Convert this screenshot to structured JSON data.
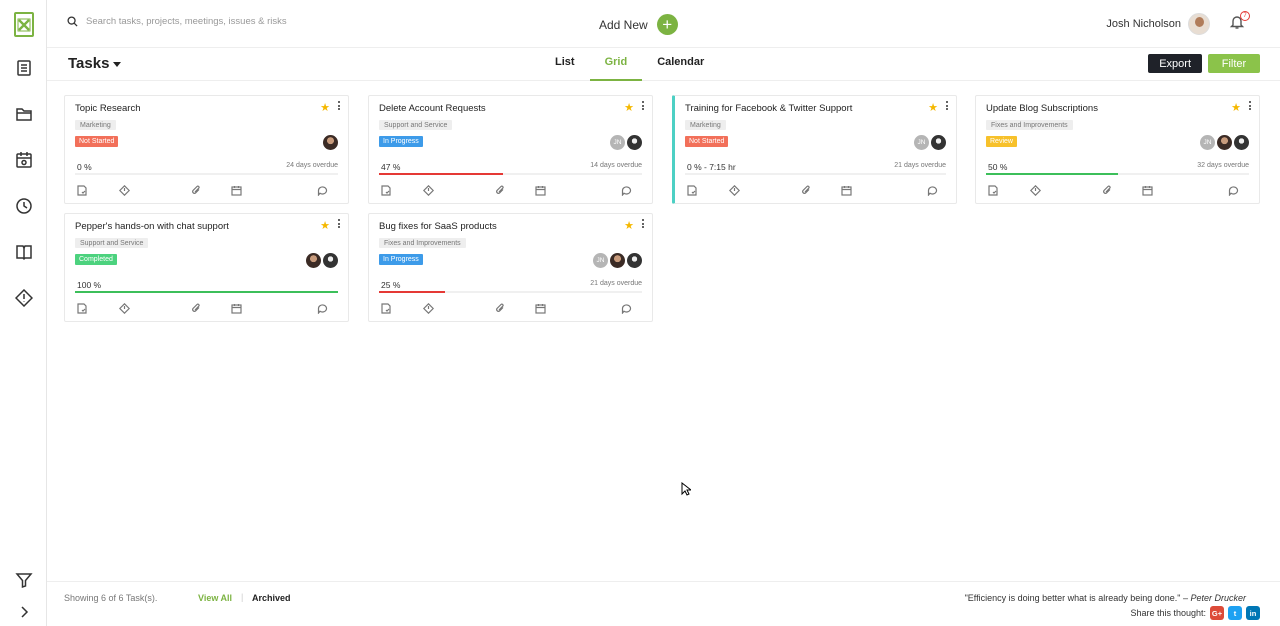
{
  "search": {
    "placeholder": "Search tasks, projects, meetings, issues & risks"
  },
  "header": {
    "add_new_label": "Add New",
    "user_name": "Josh Nicholson",
    "notification_count": "7"
  },
  "page": {
    "title": "Tasks"
  },
  "view_tabs": [
    {
      "label": "List",
      "active": false
    },
    {
      "label": "Grid",
      "active": true
    },
    {
      "label": "Calendar",
      "active": false
    }
  ],
  "actions": {
    "export_label": "Export",
    "filter_label": "Filter"
  },
  "colors": {
    "accent_green": "#7cb342",
    "status_not_started": "#f2705a",
    "status_in_progress": "#3d9be9",
    "status_review": "#f7c12b",
    "status_completed": "#4cd27e",
    "progress_red": "#e53935",
    "progress_green": "#3cbf5a",
    "card_accent_teal": "#4dd0c4"
  },
  "tasks": [
    {
      "title": "Topic Research",
      "category": "Marketing",
      "status": "Not Started",
      "status_key": "not_started",
      "progress_label": "0 %",
      "progress": 0,
      "overdue": "24 days overdue",
      "assignees": [
        "photo"
      ]
    },
    {
      "title": "Delete Account Requests",
      "category": "Support and Service",
      "status": "In Progress",
      "status_key": "in_progress",
      "progress_label": "47 %",
      "progress": 47,
      "overdue": "14 days overdue",
      "assignees": [
        "JN",
        "photo2"
      ]
    },
    {
      "title": "Training for Facebook & Twitter Support",
      "category": "Marketing",
      "status": "Not Started",
      "status_key": "not_started",
      "progress_label": "0 % - 7:15 hr",
      "progress": 0,
      "overdue": "21 days overdue",
      "assignees": [
        "JN",
        "photo2"
      ]
    },
    {
      "title": "Update Blog Subscriptions",
      "category": "Fixes and Improvements",
      "status": "Review",
      "status_key": "review",
      "progress_label": "50 %",
      "progress": 50,
      "overdue": "32 days overdue",
      "assignees": [
        "JN",
        "photo",
        "photo2"
      ]
    },
    {
      "title": "Pepper's hands-on with chat support",
      "category": "Support and Service",
      "status": "Completed",
      "status_key": "completed",
      "progress_label": "100 %",
      "progress": 100,
      "overdue": "",
      "assignees": [
        "photo",
        "photo2"
      ]
    },
    {
      "title": "Bug fixes for SaaS products",
      "category": "Fixes and Improvements",
      "status": "In Progress",
      "status_key": "in_progress",
      "progress_label": "25 %",
      "progress": 25,
      "overdue": "21 days overdue",
      "assignees": [
        "JN",
        "photo",
        "photo2"
      ]
    }
  ],
  "footer": {
    "showing": "Showing 6 of 6 Task(s).",
    "view_all": "View All",
    "separator": "|",
    "archived": "Archived",
    "quote": "\"Efficiency is doing better what is already being done.\"",
    "quote_author": "– Peter Drucker",
    "share_label": "Share this thought:",
    "social": [
      {
        "name": "google-plus",
        "glyph": "G+",
        "color": "#dd4b39"
      },
      {
        "name": "twitter",
        "glyph": "t",
        "color": "#1da1f2"
      },
      {
        "name": "linkedin",
        "glyph": "in",
        "color": "#0077b5"
      }
    ]
  }
}
